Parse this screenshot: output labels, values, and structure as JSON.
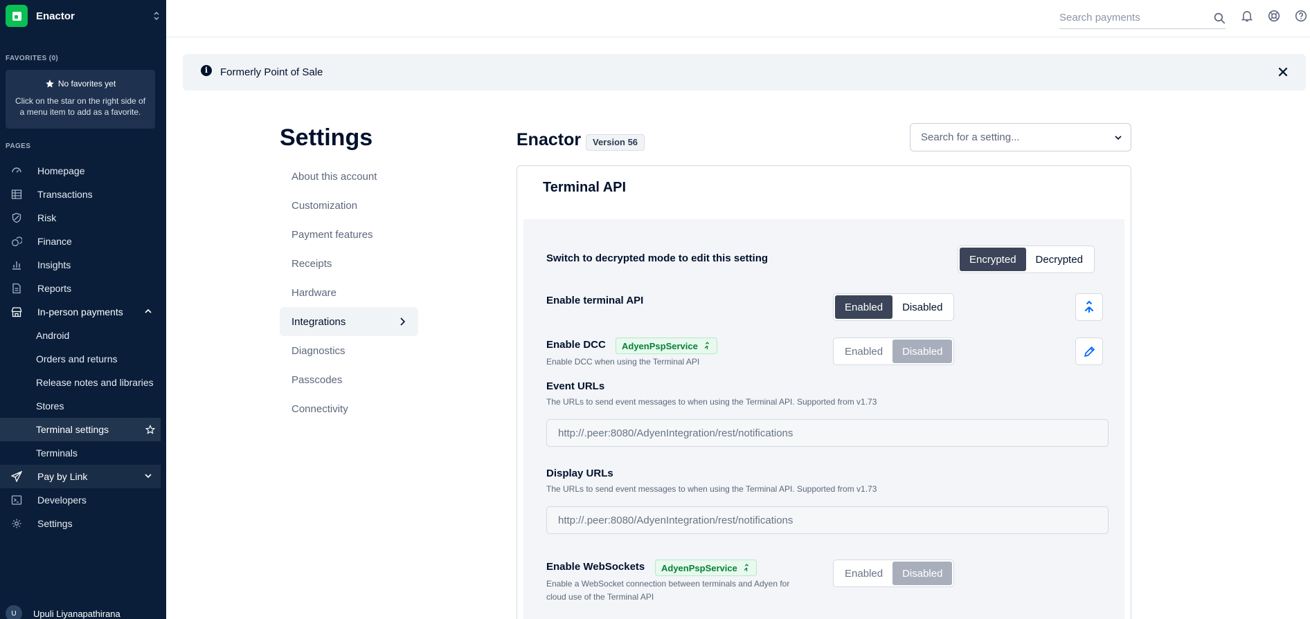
{
  "sidebar": {
    "brand": "Enactor",
    "favorites_label": "FAVORITES (0)",
    "favorites_empty_title": "No favorites yet",
    "favorites_empty_desc": "Click on the star on the right side of a menu item to add as a favorite.",
    "pages_label": "PAGES",
    "items": [
      {
        "label": "Homepage",
        "icon": "home-icon"
      },
      {
        "label": "Transactions",
        "icon": "table-icon"
      },
      {
        "label": "Risk",
        "icon": "shield-icon"
      },
      {
        "label": "Finance",
        "icon": "coins-icon"
      },
      {
        "label": "Insights",
        "icon": "bar-chart-icon"
      },
      {
        "label": "Reports",
        "icon": "document-icon"
      },
      {
        "label": "In-person payments",
        "icon": "store-icon"
      },
      {
        "label": "Android"
      },
      {
        "label": "Orders and returns"
      },
      {
        "label": "Release notes and libraries"
      },
      {
        "label": "Stores"
      },
      {
        "label": "Terminal settings"
      },
      {
        "label": "Terminals"
      },
      {
        "label": "Pay by Link",
        "icon": "paper-plane-icon"
      },
      {
        "label": "Developers",
        "icon": "terminal-icon"
      },
      {
        "label": "Settings",
        "icon": "gear-icon"
      }
    ],
    "user_name": "Upuli Liyanapathirana",
    "user_initial": "U"
  },
  "topbar": {
    "search_placeholder": "Search payments"
  },
  "banner": {
    "text": "Formerly Point of Sale"
  },
  "settings_nav": {
    "title": "Settings",
    "items": [
      "About this account",
      "Customization",
      "Payment features",
      "Receipts",
      "Hardware",
      "Integrations",
      "Diagnostics",
      "Passcodes",
      "Connectivity"
    ],
    "active": "Integrations"
  },
  "main": {
    "title": "Enactor",
    "version_badge": "Version 56",
    "setting_search_placeholder": "Search for a setting...",
    "card_title": "Terminal API",
    "mode_row": {
      "label": "Switch to decrypted mode to edit this setting",
      "options": [
        "Encrypted",
        "Decrypted"
      ],
      "selected": "Encrypted"
    },
    "terminal_api": {
      "label": "Enable terminal API",
      "options": [
        "Enabled",
        "Disabled"
      ],
      "selected": "Enabled"
    },
    "dcc": {
      "label": "Enable DCC",
      "tag": "AdyenPspService",
      "desc": "Enable DCC when using the Terminal API",
      "options": [
        "Enabled",
        "Disabled"
      ],
      "selected": "Disabled"
    },
    "event_urls": {
      "label": "Event URLs",
      "desc": "The URLs to send event messages to when using the Terminal API. Supported from v1.73",
      "value": "http://.peer:8080/AdyenIntegration/rest/notifications"
    },
    "display_urls": {
      "label": "Display URLs",
      "desc": "The URLs to send event messages to when using the Terminal API. Supported from v1.73",
      "value": "http://.peer:8080/AdyenIntegration/rest/notifications"
    },
    "websockets": {
      "label": "Enable WebSockets",
      "tag": "AdyenPspService",
      "desc_line1": "Enable a WebSocket connection between terminals and Adyen for",
      "desc_line2": "cloud use of the Terminal API",
      "options": [
        "Enabled",
        "Disabled"
      ],
      "selected": "Disabled"
    }
  },
  "colors": {
    "sidebar_bg": "#0a1e3a",
    "brand_green": "#0abf53",
    "selected_dark": "#3b4458",
    "tag_green": "#058237"
  }
}
